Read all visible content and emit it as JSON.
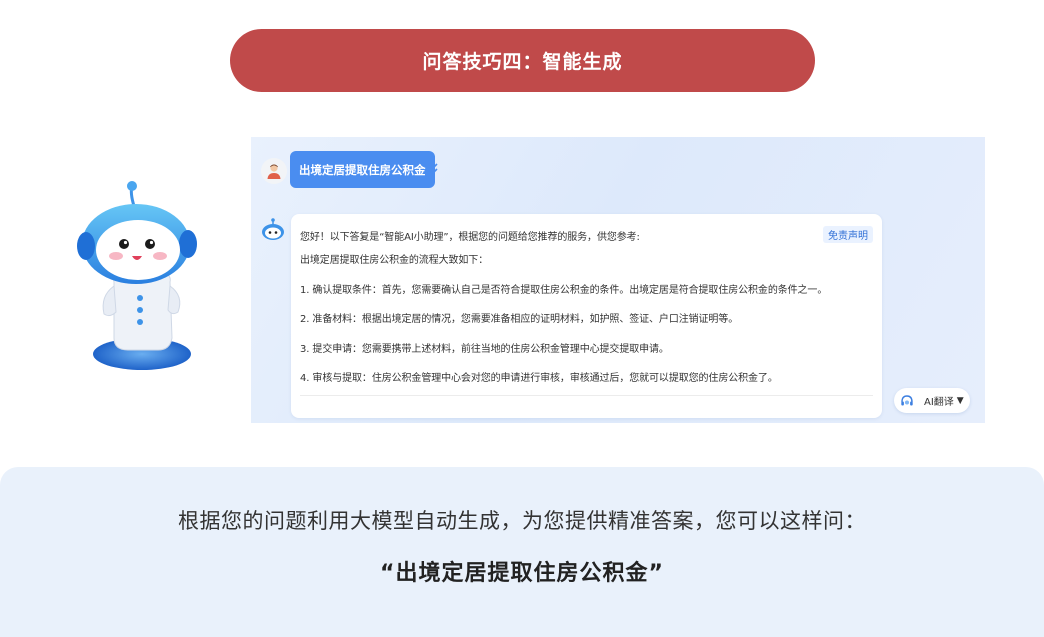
{
  "header": {
    "title": "问答技巧四：智能生成"
  },
  "chat": {
    "query": "出境定居提取住房公积金",
    "answer": {
      "disclaimer": "免责声明",
      "lines": [
        "您好！以下答复是“智能AI小助理”，根据您的问题给您推荐的服务，供您参考:",
        "出境定居提取住房公积金的流程大致如下：",
        "1. 确认提取条件：首先，您需要确认自己是否符合提取住房公积金的条件。出境定居是符合提取住房公积金的条件之一。",
        "2. 准备材料：根据出境定居的情况，您需要准备相应的证明材料，如护照、签证、户口注销证明等。",
        "3. 提交申请：您需要携带上述材料，前往当地的住房公积金管理中心提交提取申请。",
        "4. 审核与提取：住房公积金管理中心会对您的申请进行审核，审核通过后，您就可以提取您的住房公积金了。"
      ]
    },
    "translate": {
      "label": "AI翻译",
      "icon": "headset-icon"
    }
  },
  "footer": {
    "description": "根据您的问题利用大模型自动生成，为您提供精准答案，您可以这样问：",
    "example": "“出境定居提取住房公积金”"
  },
  "colors": {
    "title_bg": "#c04a4a",
    "query_bubble": "#4a8df0",
    "accent_blue": "#2f6fd6",
    "bottom_bg": "#e9f1fb"
  }
}
